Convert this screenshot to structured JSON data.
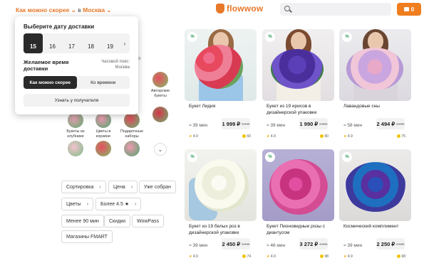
{
  "header": {
    "delivery_label": "Как можно скорее",
    "in_label": "в",
    "city": "Москва",
    "logo_text": "flowwow",
    "search_placeholder": "",
    "cart_count": "0",
    "accent": "#e8792a"
  },
  "background": {
    "title_fragment": "в",
    "sub_fragment": "ина",
    "categories": [
      {
        "label": "Авторские букеты"
      },
      {
        "label": "Букеты из клубники"
      },
      {
        "label": "Цветы в корзине"
      },
      {
        "label": "Подарочные наборы"
      }
    ]
  },
  "popup": {
    "title": "Выберите дату доставки",
    "dates": [
      "15",
      "16",
      "17",
      "18",
      "19"
    ],
    "selected_date": "15",
    "time_label": "Желаемое время доставки",
    "timezone": "Часовой пояс: Москва",
    "time_options": [
      "Как можно скорее",
      "Ко времени"
    ],
    "selected_time_option": "Как можно скорее",
    "recipient_button": "Узнать у получателя"
  },
  "filters": [
    {
      "label": "Сортировка",
      "chevron": true
    },
    {
      "label": "Цена",
      "chevron": true
    },
    {
      "label": "Уже собран",
      "chevron": false
    },
    {
      "label": "Цветы",
      "chevron": true
    },
    {
      "label": "Более 4.5 ★",
      "chevron": true
    },
    {
      "label": "Менее 90 мин",
      "chevron": false
    },
    {
      "label": "Скидки",
      "chevron": false
    },
    {
      "label": "WowPass",
      "chevron": false
    },
    {
      "label": "Магазины FMART",
      "chevron": false
    }
  ],
  "products": [
    {
      "name": "Букет Лидия",
      "time": "39 мин",
      "price": "1 999 ₽",
      "old_price": "2 599",
      "rating": "4.9",
      "reviews": "",
      "count": "60",
      "badge": "%",
      "image": "pink-roses-bouquet"
    },
    {
      "name": "Букет из 19 ирисов в дизайнерской упаковке",
      "time": "39 мин",
      "price": "1 990 ₽",
      "old_price": "2 800",
      "rating": "4.9",
      "reviews": "",
      "count": "60",
      "badge": "%",
      "image": "iris-bouquet"
    },
    {
      "name": "Лавандовые сны",
      "time": "58 мин",
      "price": "2 494 ₽",
      "old_price": "3 260",
      "rating": "4.9",
      "reviews": "",
      "count": "75",
      "badge": "%",
      "image": "lavender-bouquet"
    },
    {
      "name": "Букет из 19 белых роз в дизайнерской упаковке",
      "time": "39 мин",
      "price": "2 450 ₽",
      "old_price": "3 200",
      "rating": "4.9",
      "reviews": "",
      "count": "74",
      "badge": "%",
      "image": "white-roses-bouquet"
    },
    {
      "name": "Букет Пионовидные розы с диантусом",
      "time": "46 мин",
      "price": "3 272 ₽",
      "old_price": "4 300",
      "rating": "4.9",
      "reviews": "",
      "count": "98",
      "badge": "%",
      "image": "peony-roses-bouquet"
    },
    {
      "name": "Космический комплимент",
      "time": "39 мин",
      "price": "2 250 ₽",
      "old_price": "2 900",
      "rating": "4.9",
      "reviews": "",
      "count": "68",
      "badge": "%",
      "image": "blue-roses-bouquet"
    }
  ]
}
